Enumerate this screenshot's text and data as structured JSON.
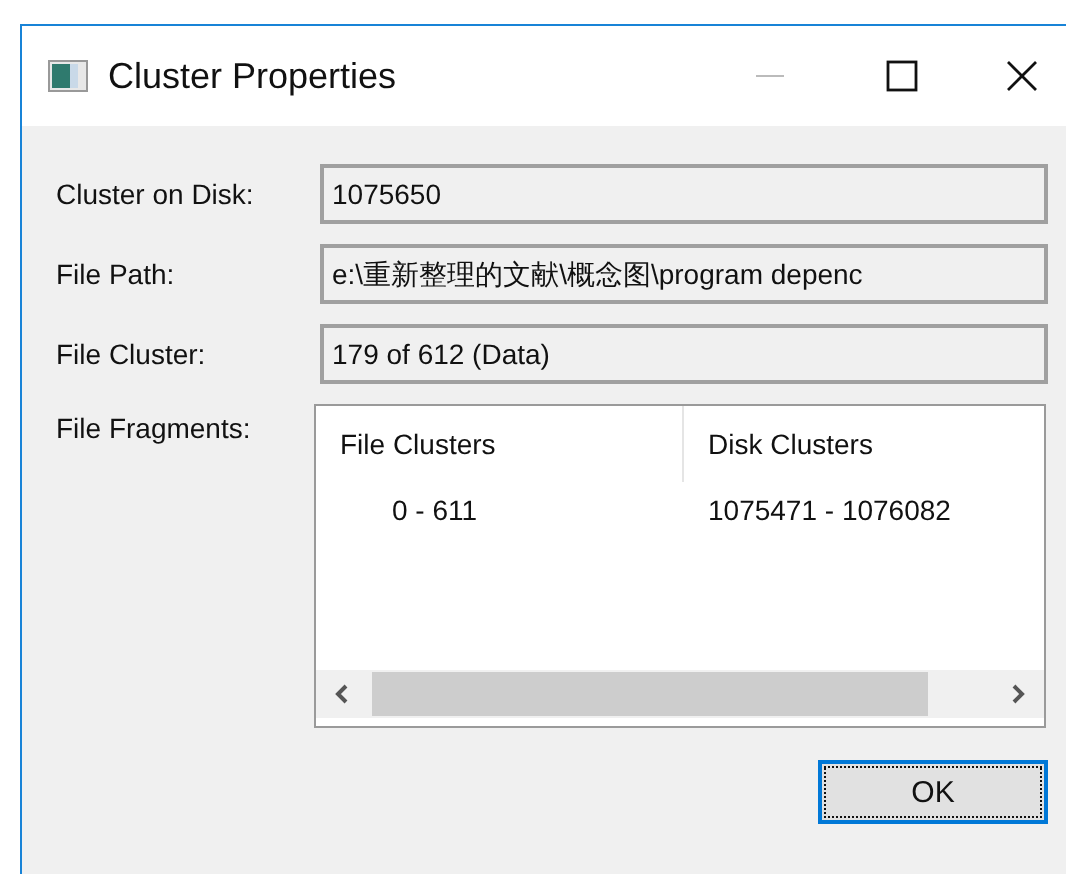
{
  "window": {
    "title": "Cluster Properties"
  },
  "fields": [
    {
      "label": "Cluster on Disk:",
      "value": "1075650"
    },
    {
      "label": "File Path:",
      "value": "e:\\重新整理的文献\\概念图\\program depenc"
    },
    {
      "label": "File Cluster:",
      "value": "179 of 612 (Data)"
    }
  ],
  "fragments": {
    "label": "File Fragments:",
    "columns": [
      "File Clusters",
      "Disk Clusters"
    ],
    "rows": [
      [
        "0 - 611",
        "1075471 - 1076082"
      ]
    ]
  },
  "buttons": [
    {
      "label": "OK",
      "focused": true
    }
  ]
}
